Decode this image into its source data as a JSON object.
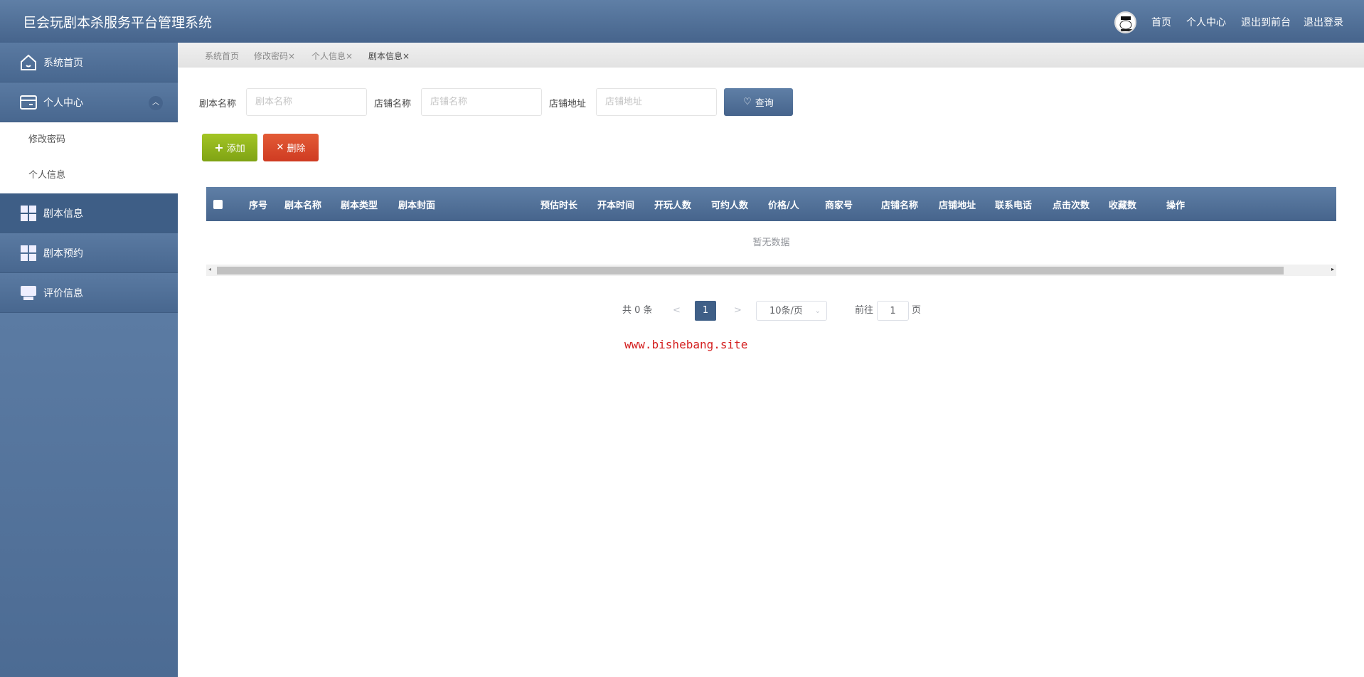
{
  "header": {
    "title": "巨会玩剧本杀服务平台管理系统",
    "nav": [
      "首页",
      "个人中心",
      "退出到前台",
      "退出登录"
    ]
  },
  "sidebar": {
    "items": [
      {
        "label": "系统首页",
        "icon": "home-icon"
      },
      {
        "label": "个人中心",
        "icon": "card-icon",
        "submenu": [
          "修改密码",
          "个人信息"
        ]
      },
      {
        "label": "剧本信息",
        "icon": "grid-icon"
      },
      {
        "label": "剧本预约",
        "icon": "grid-icon"
      },
      {
        "label": "评价信息",
        "icon": "monitor-icon"
      }
    ]
  },
  "tabs": [
    "系统首页",
    "修改密码×",
    "个人信息×",
    "剧本信息×"
  ],
  "search": {
    "fields": [
      {
        "label": "剧本名称",
        "placeholder": "剧本名称",
        "value": ""
      },
      {
        "label": "店铺名称",
        "placeholder": "店铺名称",
        "value": ""
      },
      {
        "label": "店铺地址",
        "placeholder": "店铺地址",
        "value": ""
      }
    ],
    "button": "查询"
  },
  "actions": {
    "add": "添加",
    "delete": "删除"
  },
  "colors": {
    "add": "#8db31a",
    "delete": "#d9482d",
    "primary": "#4f6f97"
  },
  "table": {
    "columns": [
      "序号",
      "剧本名称",
      "剧本类型",
      "剧本封面",
      "预估时长",
      "开本时间",
      "开玩人数",
      "可约人数",
      "价格/人",
      "商家号",
      "店铺名称",
      "店铺地址",
      "联系电话",
      "点击次数",
      "收藏数",
      "操作"
    ],
    "rows": [],
    "empty": "暂无数据"
  },
  "pagination": {
    "total": "共 0 条",
    "prev": "<",
    "current": "1",
    "next": ">",
    "page_size": "10条/页",
    "goto": "前往",
    "goto_value": "1",
    "page_unit": "页"
  },
  "watermark": "www.bishebang.site"
}
